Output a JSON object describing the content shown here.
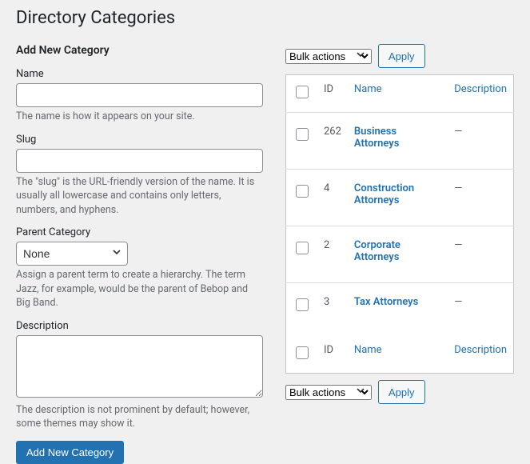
{
  "page_title": "Directory Categories",
  "form": {
    "heading": "Add New Category",
    "name": {
      "label": "Name",
      "value": "",
      "help": "The name is how it appears on your site."
    },
    "slug": {
      "label": "Slug",
      "value": "",
      "help": "The \"slug\" is the URL-friendly version of the name. It is usually all lowercase and contains only letters, numbers, and hyphens."
    },
    "parent": {
      "label": "Parent Category",
      "selected": "None",
      "help": "Assign a parent term to create a hierarchy. The term Jazz, for example, would be the parent of Bebop and Big Band."
    },
    "description": {
      "label": "Description",
      "value": "",
      "help": "The description is not prominent by default; however, some themes may show it."
    },
    "submit": "Add New Category"
  },
  "bulk": {
    "selected": "Bulk actions",
    "apply": "Apply"
  },
  "table": {
    "columns": {
      "id": "ID",
      "name": "Name",
      "description": "Description"
    },
    "rows": [
      {
        "id": "262",
        "name": "Business Attorneys",
        "description": "—"
      },
      {
        "id": "4",
        "name": "Construction Attorneys",
        "description": "—"
      },
      {
        "id": "2",
        "name": "Corporate Attorneys",
        "description": "—"
      },
      {
        "id": "3",
        "name": "Tax Attorneys",
        "description": "—"
      }
    ]
  }
}
